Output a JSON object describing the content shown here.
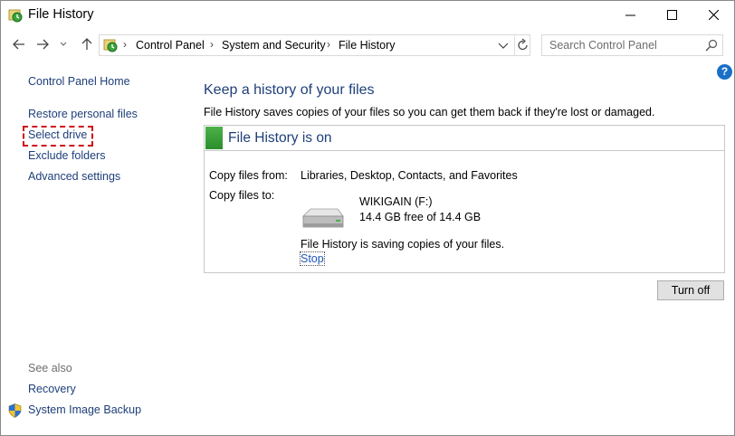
{
  "window": {
    "title": "File History"
  },
  "address_bar": {
    "crumbs": [
      "Control Panel",
      "System and Security",
      "File History"
    ]
  },
  "search": {
    "placeholder": "Search Control Panel"
  },
  "help": {
    "label": "?"
  },
  "left_pane": {
    "home": "Control Panel Home",
    "items": [
      "Restore personal files",
      "Select drive",
      "Exclude folders",
      "Advanced settings"
    ],
    "see_also_label": "See also",
    "see_also": [
      "Recovery",
      "System Image Backup"
    ]
  },
  "main": {
    "heading": "Keep a history of your files",
    "description": "File History saves copies of your files so you can get them back if they're lost or damaged.",
    "panel": {
      "title": "File History is on",
      "copy_from_label": "Copy files from:",
      "copy_from_value": "Libraries, Desktop, Contacts, and Favorites",
      "copy_to_label": "Copy files to:",
      "drive_name": "WIKIGAIN (F:)",
      "drive_free": "14.4 GB free of 14.4 GB",
      "status": "File History is saving copies of your files.",
      "stop_link": "Stop"
    },
    "turn_off_button": "Turn off"
  },
  "colors": {
    "link": "#1e3f7a",
    "accent_green": "#2a8f2b",
    "highlight_border": "#d0101a"
  }
}
